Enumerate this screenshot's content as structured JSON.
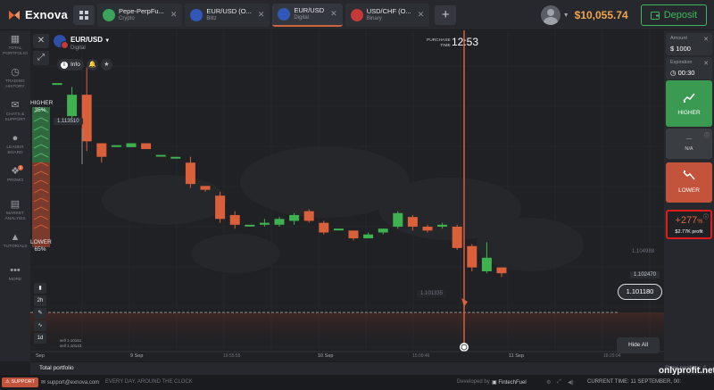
{
  "header": {
    "logo_text": "Exnova",
    "tabs": [
      {
        "name": "Pepe-PerpFu...",
        "sub": "Crypto",
        "color": "#3aa55a"
      },
      {
        "name": "EUR/USD (O...",
        "sub": "Blitz",
        "color": "#3257b8"
      },
      {
        "name": "EUR/USD",
        "sub": "Digital",
        "color": "#3257b8",
        "active": true
      },
      {
        "name": "USD/CHF (O...",
        "sub": "Binary",
        "color": "#c43a3a"
      }
    ],
    "add_tab": "+",
    "balance": "$10,055.74",
    "deposit_label": "Deposit"
  },
  "sidebar": {
    "items": [
      {
        "icon": "portfolio-icon",
        "label": "TOTAL PORTFOLIO"
      },
      {
        "icon": "history-icon",
        "label": "TRADING HISTORY"
      },
      {
        "icon": "chat-icon",
        "label": "CHATS & SUPPORT"
      },
      {
        "icon": "leaderboard-icon",
        "label": "LEADER BOARD"
      },
      {
        "icon": "promo-icon",
        "label": "PROMO"
      },
      {
        "icon": "market-icon",
        "label": "MARKET ANALYSIS"
      },
      {
        "icon": "tutorials-icon",
        "label": "TUTORIALS"
      },
      {
        "icon": "more-icon",
        "label": "MORE"
      }
    ]
  },
  "chart": {
    "asset_name": "EUR/USD",
    "asset_sub": "Digital",
    "info_label": "Info",
    "purchase_label_1": "PURCHASE",
    "purchase_label_2": "TIME",
    "purchase_time": "12:53",
    "higher_label": "HIGHER",
    "higher_pct": "35%",
    "lower_label": "LOWER",
    "lower_pct": "65%",
    "price_high": "1.113510",
    "price_right_1": "1.104988",
    "price_right_2": "1.102470",
    "price_mid": "1.101335",
    "current_price": "1.101180",
    "hide_all": "Hide All",
    "timeframes": [
      "2h",
      "1d"
    ],
    "sell_info_1": "sell 1.10151",
    "sell_info_2": "sell 1.10143",
    "x_labels": [
      "Sep",
      "9 Sep",
      "19:55:55",
      "10 Sep",
      "15:09:46",
      "11 Sep",
      "18:29:04"
    ]
  },
  "right_panel": {
    "amount_label": "Amount",
    "amount_value": "$ 1000",
    "expiration_label": "Expiration",
    "expiration_value": "00:30",
    "higher_btn": "HIGHER",
    "na_label": "N/A",
    "lower_btn": "LOWER",
    "profit_pct": "+277",
    "profit_pct_sign": "%",
    "profit_value": "$2.77K profit"
  },
  "portfolio_bar": {
    "title": "Total portfolio",
    "right": "Show positions"
  },
  "statusbar": {
    "support": "SUPPORT",
    "email": "support@exnova.com",
    "hours": "EVERY DAY, AROUND THE CLOCK",
    "developed": "Developed by",
    "dev_name": "FintechFuel",
    "current_time": "CURRENT TIME: 11 SEPTEMBER, 00:"
  },
  "watermark": "onlyprofit.net",
  "chart_data": {
    "type": "candlestick",
    "candles": [
      {
        "o": 1.113,
        "c": 1.113,
        "h": 1.113,
        "l": 1.113
      },
      {
        "o": 1.1113,
        "c": 1.1124,
        "h": 1.1128,
        "l": 1.1111
      },
      {
        "o": 1.1124,
        "c": 1.11,
        "h": 1.1138,
        "l": 1.1095
      },
      {
        "o": 1.1099,
        "c": 1.1092,
        "h": 1.1099,
        "l": 1.1089
      },
      {
        "o": 1.1098,
        "c": 1.1098,
        "h": 1.1098,
        "l": 1.1098
      },
      {
        "o": 1.1097,
        "c": 1.1099,
        "h": 1.1099,
        "l": 1.1097
      },
      {
        "o": 1.1099,
        "c": 1.1096,
        "h": 1.1099,
        "l": 1.1096
      },
      {
        "o": 1.1093,
        "c": 1.1093,
        "h": 1.1093,
        "l": 1.1093
      },
      {
        "o": 1.1092,
        "c": 1.1092,
        "h": 1.1092,
        "l": 1.1092
      },
      {
        "o": 1.1089,
        "c": 1.1078,
        "h": 1.1092,
        "l": 1.1076
      },
      {
        "o": 1.1077,
        "c": 1.1075,
        "h": 1.1077,
        "l": 1.1074
      },
      {
        "o": 1.1072,
        "c": 1.106,
        "h": 1.1074,
        "l": 1.1058
      },
      {
        "o": 1.1062,
        "c": 1.1057,
        "h": 1.1064,
        "l": 1.1055
      },
      {
        "o": 1.1057,
        "c": 1.1057,
        "h": 1.1057,
        "l": 1.1057
      },
      {
        "o": 1.1057,
        "c": 1.1058,
        "h": 1.106,
        "l": 1.1056
      },
      {
        "o": 1.1057,
        "c": 1.106,
        "h": 1.1061,
        "l": 1.1056
      },
      {
        "o": 1.1059,
        "c": 1.1062,
        "h": 1.1063,
        "l": 1.1057
      },
      {
        "o": 1.1064,
        "c": 1.1059,
        "h": 1.1065,
        "l": 1.1058
      },
      {
        "o": 1.1058,
        "c": 1.1053,
        "h": 1.1059,
        "l": 1.1052
      },
      {
        "o": 1.1055,
        "c": 1.1055,
        "h": 1.1055,
        "l": 1.1055
      },
      {
        "o": 1.1054,
        "c": 1.105,
        "h": 1.1054,
        "l": 1.1049
      },
      {
        "o": 1.105,
        "c": 1.1052,
        "h": 1.1053,
        "l": 1.105
      },
      {
        "o": 1.1053,
        "c": 1.1055,
        "h": 1.1055,
        "l": 1.1052
      },
      {
        "o": 1.1056,
        "c": 1.1063,
        "h": 1.1064,
        "l": 1.1055
      },
      {
        "o": 1.1061,
        "c": 1.1056,
        "h": 1.1062,
        "l": 1.1054
      },
      {
        "o": 1.1056,
        "c": 1.1054,
        "h": 1.1057,
        "l": 1.1053
      },
      {
        "o": 1.1056,
        "c": 1.1057,
        "h": 1.1058,
        "l": 1.1055
      },
      {
        "o": 1.1056,
        "c": 1.1045,
        "h": 1.1057,
        "l": 1.1044
      },
      {
        "o": 1.1046,
        "c": 1.1035,
        "h": 1.1047,
        "l": 1.1033
      },
      {
        "o": 1.1033,
        "c": 1.104,
        "h": 1.1048,
        "l": 1.1032
      },
      {
        "o": 1.1035,
        "c": 1.1032,
        "h": 1.1035,
        "l": 1.103
      }
    ],
    "current_price": 1.10118,
    "ylim": [
      1.101,
      1.1148
    ]
  }
}
